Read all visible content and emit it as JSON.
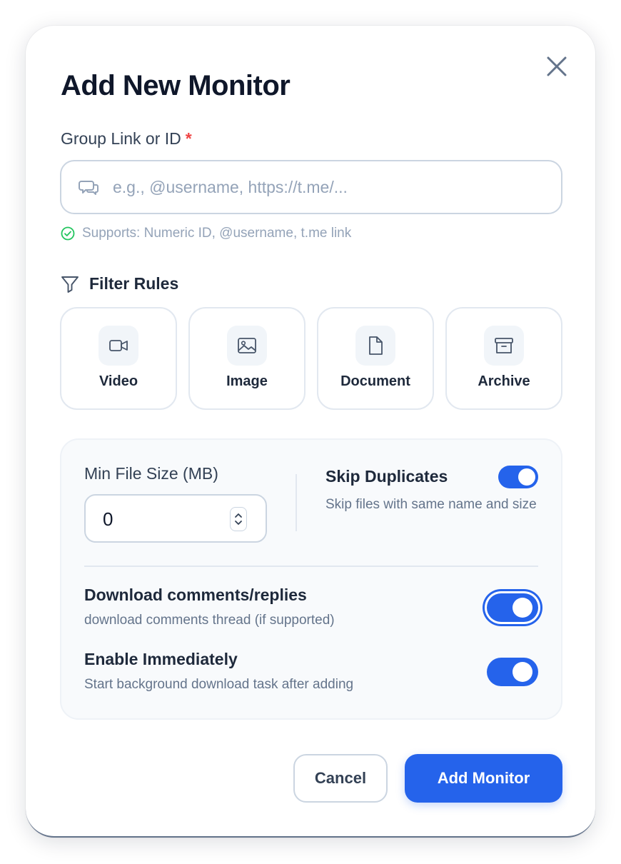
{
  "dialog": {
    "title": "Add New Monitor"
  },
  "group_field": {
    "label": "Group Link or ID",
    "required_mark": "*",
    "placeholder": "e.g., @username, https://t.me/...",
    "value": "",
    "hint": "Supports: Numeric ID, @username, t.me link"
  },
  "filter_rules": {
    "title": "Filter Rules",
    "items": [
      {
        "label": "Video",
        "icon": "video-camera-icon"
      },
      {
        "label": "Image",
        "icon": "image-icon"
      },
      {
        "label": "Document",
        "icon": "document-icon"
      },
      {
        "label": "Archive",
        "icon": "archive-box-icon"
      }
    ]
  },
  "options": {
    "min_file_size": {
      "label": "Min File Size (MB)",
      "value": "0"
    },
    "skip_duplicates": {
      "title": "Skip Duplicates",
      "description": "Skip files with same name and size",
      "enabled": true
    },
    "download_comments": {
      "title": "Download comments/replies",
      "description": "download comments thread (if supported)",
      "enabled": true
    },
    "enable_immediately": {
      "title": "Enable Immediately",
      "description": "Start background download task after adding",
      "enabled": true
    }
  },
  "actions": {
    "cancel_label": "Cancel",
    "submit_label": "Add Monitor"
  },
  "colors": {
    "accent": "#2563eb",
    "required": "#ef4444",
    "success": "#22c55e"
  }
}
